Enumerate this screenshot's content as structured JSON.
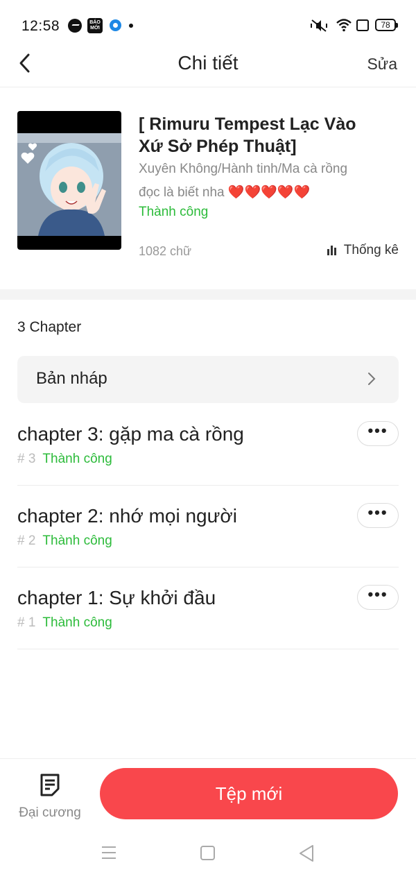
{
  "status_bar": {
    "time": "12:58",
    "battery": "78",
    "icons": [
      "messenger-icon",
      "baomoi-icon",
      "app-circle-icon",
      "notification-dot",
      "silent-icon",
      "wifi-icon",
      "sim-icon",
      "battery-icon"
    ],
    "baomoi_text": "BÁO MỚI"
  },
  "header": {
    "title": "Chi tiết",
    "edit_label": "Sửa",
    "back_icon": "chevron-left-icon"
  },
  "story": {
    "title": "[ Rimuru Tempest Lạc Vào Xứ Sở Phép Thuật]",
    "genre": "Xuyên Không/Hành tinh/Ma cà rồng",
    "description": "đọc là biết nha ❤️❤️❤️❤️❤️",
    "status": "Thành công",
    "word_count": "1082 chữ",
    "stats_label": "Thống kê"
  },
  "chapters": {
    "count_label": "3 Chapter",
    "draft_label": "Bản nháp",
    "items": [
      {
        "title": "chapter 3: gặp ma cà rồng",
        "number": "# 3",
        "status": "Thành công"
      },
      {
        "title": "chapter 2: nhớ mọi người",
        "number": "# 2",
        "status": "Thành công"
      },
      {
        "title": "chapter 1: Sự khởi đầu",
        "number": "# 1",
        "status": "Thành công"
      }
    ],
    "more_label": "•••"
  },
  "bottom_bar": {
    "outline_label": "Đại cương",
    "new_file_label": "Tệp mới"
  },
  "colors": {
    "accent": "#f9474c",
    "success": "#2cbb3a",
    "muted": "#888888"
  }
}
